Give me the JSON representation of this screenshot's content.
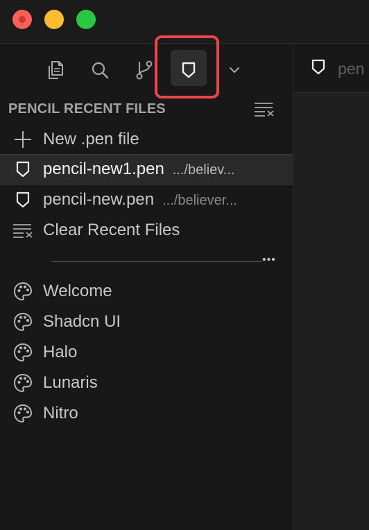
{
  "sidebar": {
    "section_title": "PENCIL RECENT FILES",
    "new_file_label": "New .pen file",
    "recent_files": [
      {
        "name": "pencil-new1.pen",
        "path": ".../believ...",
        "selected": true
      },
      {
        "name": "pencil-new.pen",
        "path": ".../believer...",
        "selected": false
      }
    ],
    "clear_label": "Clear Recent Files",
    "examples": [
      {
        "label": "Welcome"
      },
      {
        "label": "Shadcn UI"
      },
      {
        "label": "Halo"
      },
      {
        "label": "Lunaris"
      },
      {
        "label": "Nitro"
      }
    ]
  },
  "activity_bar": {
    "icons": [
      "files-icon",
      "search-icon",
      "source-control-icon",
      "pencil-icon",
      "chevron-down-icon"
    ],
    "active": "pencil-icon"
  },
  "editor": {
    "tab_label": "pen"
  },
  "colors": {
    "highlight": "#e8464c",
    "background": "#181818",
    "traffic_red": "#fe5f57",
    "traffic_yellow": "#febc2e",
    "traffic_green": "#28c840"
  }
}
